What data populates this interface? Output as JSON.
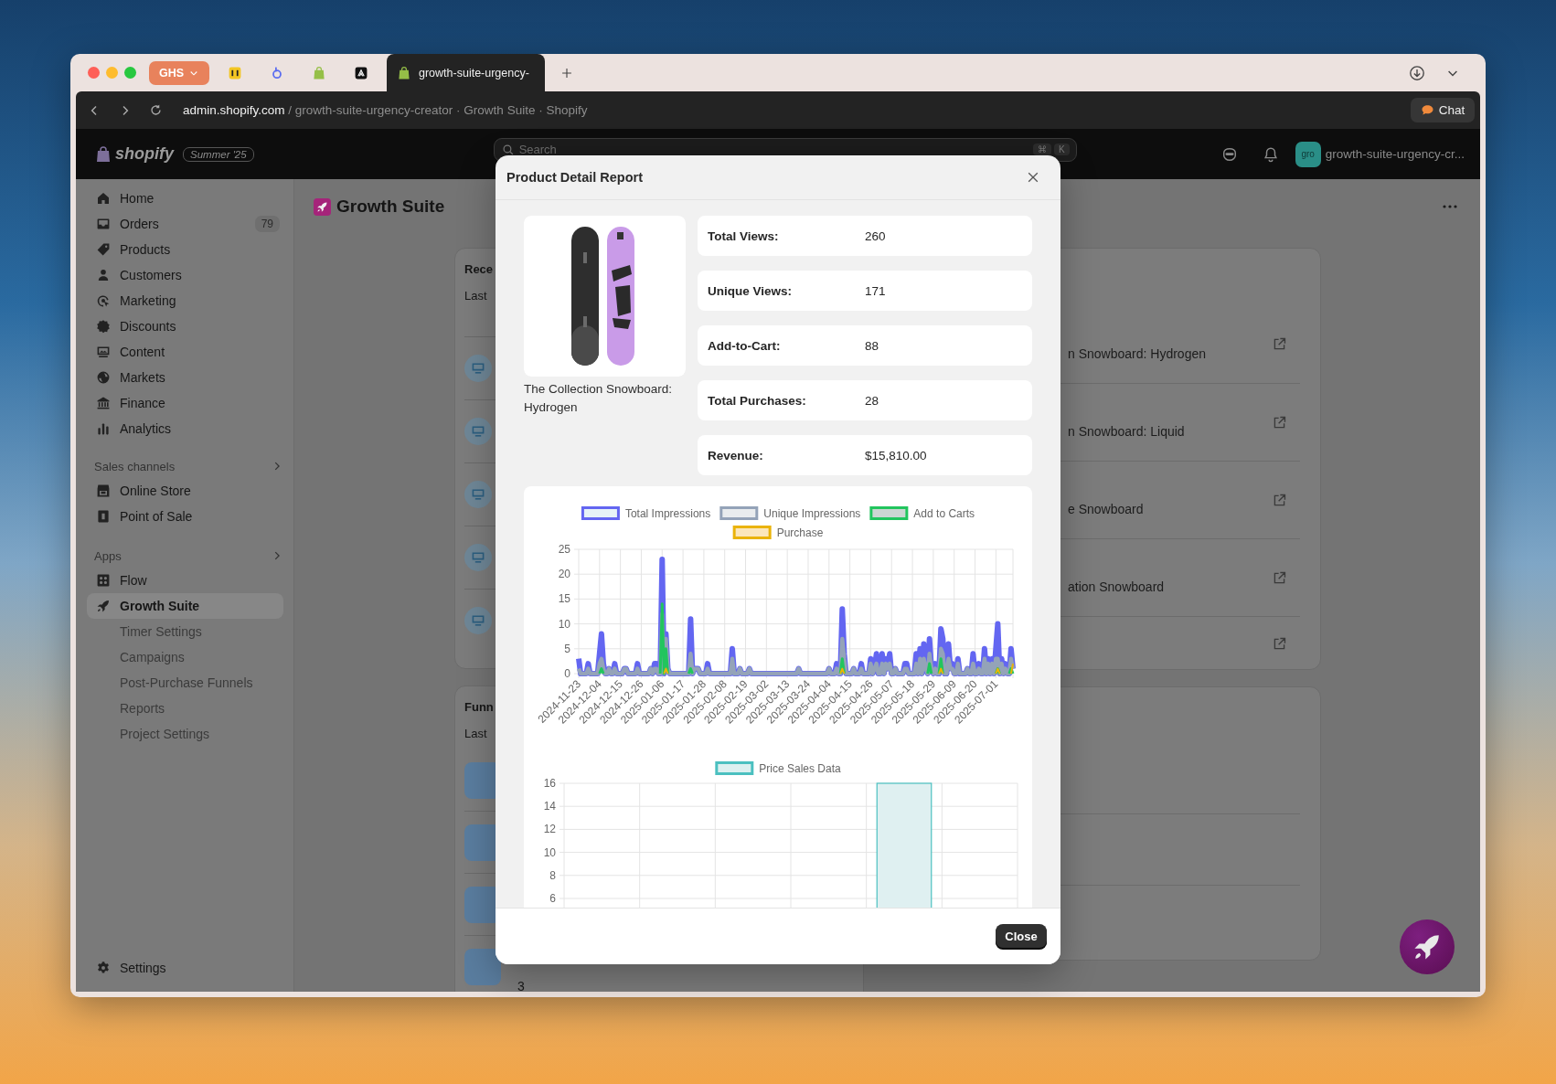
{
  "browser": {
    "profile": "GHS",
    "tabs": [
      {
        "selected": false
      },
      {
        "selected": false
      },
      {
        "selected": false
      },
      {
        "selected": false
      },
      {
        "title": "growth-suite-urgency-",
        "selected": true
      }
    ]
  },
  "address_bar": {
    "host": "admin.shopify.com",
    "path": " / growth-suite-urgency-creator · Growth Suite · Shopify",
    "chat_button": "Chat"
  },
  "topbar": {
    "logo": "shopify",
    "edition": "Summer '25",
    "search": {
      "placeholder": "Search",
      "shortcut": [
        "⌘",
        "K"
      ]
    },
    "store": {
      "avatar": "gro",
      "name": "growth-suite-urgency-cr..."
    }
  },
  "sidebar": {
    "items": [
      {
        "label": "Home",
        "selected": false
      },
      {
        "label": "Orders",
        "badge": "79",
        "selected": false
      },
      {
        "label": "Products",
        "selected": false
      },
      {
        "label": "Customers",
        "selected": false
      },
      {
        "label": "Marketing",
        "selected": false
      },
      {
        "label": "Discounts",
        "selected": false
      },
      {
        "label": "Content",
        "selected": false
      },
      {
        "label": "Markets",
        "selected": false
      },
      {
        "label": "Finance",
        "selected": false
      },
      {
        "label": "Analytics",
        "selected": false
      }
    ],
    "sections": [
      {
        "title": "Sales channels",
        "items": [
          {
            "label": "Online Store",
            "selected": false
          },
          {
            "label": "Point of Sale",
            "selected": false
          }
        ]
      },
      {
        "title": "Apps",
        "items": [
          {
            "label": "Flow",
            "selected": false
          },
          {
            "label": "Growth Suite",
            "selected": true,
            "children": [
              {
                "label": "Timer Settings",
                "selected": false
              },
              {
                "label": "Campaigns",
                "selected": false
              },
              {
                "label": "Post-Purchase Funnels",
                "selected": false
              },
              {
                "label": "Reports",
                "selected": false
              },
              {
                "label": "Project Settings",
                "selected": false
              }
            ]
          }
        ]
      }
    ],
    "footer": [
      {
        "label": "Settings",
        "selected": false
      }
    ]
  },
  "page": {
    "title": "Growth Suite"
  },
  "cards": [
    {
      "kind": "list",
      "title": "Rece",
      "subtitle": "Last",
      "rows": [
        {
          "kind": "device"
        },
        {
          "kind": "device"
        },
        {
          "kind": "device"
        },
        {
          "kind": "device"
        },
        {
          "kind": "device"
        }
      ]
    },
    {
      "kind": "list",
      "title": "Funn",
      "subtitle": "Last",
      "rows": [
        {
          "kind": "app"
        },
        {
          "kind": "app"
        },
        {
          "kind": "app"
        },
        {
          "kind": "app",
          "value": "3"
        }
      ]
    },
    {
      "kind": "links",
      "rows": [
        {
          "kind": "link",
          "text": "n Snowboard: Hydrogen"
        },
        {
          "kind": "link",
          "text": "n Snowboard: Liquid"
        },
        {
          "kind": "link",
          "text": "e Snowboard"
        },
        {
          "kind": "link",
          "text": "ation Snowboard"
        },
        {
          "kind": "link"
        }
      ]
    }
  ],
  "modal": {
    "title": "Product Detail Report",
    "product": {
      "name": "The Collection Snowboard: Hydrogen"
    },
    "stats": [
      {
        "label": "Total Views:",
        "value": "260"
      },
      {
        "label": "Unique Views:",
        "value": "171"
      },
      {
        "label": "Add-to-Cart:",
        "value": "88"
      },
      {
        "label": "Total Purchases:",
        "value": "28"
      },
      {
        "label": "Revenue:",
        "value": "$15,810.00"
      }
    ],
    "charts": [
      {
        "chart_data": {
          "type": "line",
          "grid": true,
          "legend": "top",
          "ylim": [
            0,
            25
          ],
          "yticks": [
            0,
            5,
            10,
            15,
            20,
            25
          ],
          "categories": [
            "2024-11-23",
            null,
            null,
            null,
            null,
            null,
            null,
            null,
            null,
            null,
            null,
            "2024-12-04",
            null,
            null,
            null,
            null,
            null,
            null,
            null,
            null,
            null,
            null,
            "2024-12-15",
            null,
            null,
            null,
            null,
            null,
            null,
            null,
            null,
            null,
            null,
            "2024-12-26",
            null,
            null,
            null,
            null,
            null,
            null,
            null,
            null,
            null,
            null,
            "2025-01-06",
            null,
            null,
            null,
            null,
            null,
            null,
            null,
            null,
            null,
            null,
            "2025-01-17",
            null,
            null,
            null,
            null,
            null,
            null,
            null,
            null,
            null,
            null,
            "2025-01-28",
            null,
            null,
            null,
            null,
            null,
            null,
            null,
            null,
            null,
            null,
            "2025-02-08",
            null,
            null,
            null,
            null,
            null,
            null,
            null,
            null,
            null,
            null,
            "2025-02-19",
            null,
            null,
            null,
            null,
            null,
            null,
            null,
            null,
            null,
            null,
            "2025-03-02",
            null,
            null,
            null,
            null,
            null,
            null,
            null,
            null,
            null,
            null,
            "2025-03-13",
            null,
            null,
            null,
            null,
            null,
            null,
            null,
            null,
            null,
            null,
            "2025-03-24",
            null,
            null,
            null,
            null,
            null,
            null,
            null,
            null,
            null,
            null,
            "2025-04-04",
            null,
            null,
            null,
            null,
            null,
            null,
            null,
            null,
            null,
            null,
            "2025-04-15",
            null,
            null,
            null,
            null,
            null,
            null,
            null,
            null,
            null,
            null,
            "2025-04-26",
            null,
            null,
            null,
            null,
            null,
            null,
            null,
            null,
            null,
            null,
            "2025-05-07",
            null,
            null,
            null,
            null,
            null,
            null,
            null,
            null,
            null,
            null,
            "2025-05-18",
            null,
            null,
            null,
            null,
            null,
            null,
            null,
            null,
            null,
            null,
            "2025-05-29",
            null,
            null,
            null,
            null,
            null,
            null,
            null,
            null,
            null,
            null,
            "2025-06-09",
            null,
            null,
            null,
            null,
            null,
            null,
            null,
            null,
            null,
            null,
            "2025-06-20",
            null,
            null,
            null,
            null,
            null,
            null,
            null,
            null,
            null,
            null,
            "2025-07-01",
            null,
            null,
            null,
            null,
            null,
            null,
            null,
            null,
            null
          ],
          "series": [
            {
              "name": "Total Impressions",
              "color": "#6366f1",
              "values": [
                3,
                0,
                0,
                0,
                0,
                2,
                0,
                0,
                0,
                0,
                0,
                4,
                8,
                2,
                0,
                0,
                1,
                0,
                0,
                2,
                0,
                0,
                0,
                0,
                1,
                1,
                0,
                0,
                0,
                0,
                0,
                2,
                0,
                0,
                0,
                0,
                0,
                0,
                1,
                0,
                2,
                2,
                0,
                0,
                23,
                0,
                8,
                1,
                0,
                0,
                0,
                0,
                0,
                0,
                0,
                0,
                0,
                0,
                0,
                11,
                0,
                1,
                1,
                1,
                0,
                0,
                0,
                0,
                2,
                0,
                0,
                0,
                0,
                0,
                0,
                0,
                0,
                0,
                0,
                0,
                0,
                5,
                0,
                0,
                0,
                1,
                0,
                0,
                0,
                0,
                1,
                0,
                0,
                0,
                0,
                0,
                0,
                0,
                0,
                0,
                0,
                0,
                0,
                0,
                0,
                0,
                0,
                0,
                0,
                0,
                0,
                0,
                0,
                0,
                0,
                0,
                1,
                0,
                0,
                0,
                0,
                0,
                0,
                0,
                0,
                0,
                0,
                0,
                0,
                0,
                0,
                0,
                1,
                0,
                0,
                0,
                2,
                0,
                0,
                13,
                4,
                0,
                0,
                0,
                0,
                1,
                0,
                0,
                0,
                2,
                0,
                0,
                0,
                0,
                3,
                0,
                1,
                4,
                0,
                0,
                4,
                0,
                3,
                1,
                4,
                0,
                0,
                1,
                0,
                0,
                0,
                0,
                2,
                2,
                0,
                0,
                0,
                0,
                4,
                0,
                5,
                0,
                6,
                1,
                0,
                7,
                1,
                0,
                2,
                0,
                0,
                9,
                7,
                0,
                0,
                6,
                1,
                2,
                0,
                0,
                3,
                0,
                0,
                0,
                0,
                1,
                0,
                0,
                4,
                0,
                0,
                2,
                0,
                0,
                5,
                0,
                3,
                0,
                3,
                0,
                5,
                10,
                0,
                3,
                0,
                2,
                0,
                0,
                5,
                1
              ]
            },
            {
              "name": "Unique Impressions",
              "color": "#94a3b8",
              "values": [
                1,
                0,
                0,
                0,
                0,
                1,
                0,
                0,
                0,
                0,
                0,
                2,
                3,
                1,
                0,
                0,
                1,
                0,
                0,
                1,
                0,
                0,
                0,
                0,
                1,
                1,
                0,
                0,
                0,
                0,
                0,
                1,
                0,
                0,
                0,
                0,
                0,
                0,
                1,
                0,
                1,
                1,
                0,
                0,
                12,
                0,
                7,
                1,
                0,
                0,
                0,
                0,
                0,
                0,
                0,
                0,
                0,
                0,
                0,
                4,
                0,
                1,
                1,
                1,
                0,
                0,
                0,
                0,
                1,
                0,
                0,
                0,
                0,
                0,
                0,
                0,
                0,
                0,
                0,
                0,
                0,
                3,
                0,
                0,
                0,
                1,
                0,
                0,
                0,
                0,
                1,
                0,
                0,
                0,
                0,
                0,
                0,
                0,
                0,
                0,
                0,
                0,
                0,
                0,
                0,
                0,
                0,
                0,
                0,
                0,
                0,
                0,
                0,
                0,
                0,
                0,
                1,
                0,
                0,
                0,
                0,
                0,
                0,
                0,
                0,
                0,
                0,
                0,
                0,
                0,
                0,
                0,
                1,
                0,
                0,
                0,
                1,
                0,
                0,
                7,
                3,
                0,
                0,
                0,
                0,
                1,
                0,
                0,
                0,
                1,
                0,
                0,
                0,
                0,
                2,
                0,
                1,
                2,
                0,
                0,
                2,
                0,
                2,
                1,
                2,
                0,
                0,
                1,
                0,
                0,
                0,
                0,
                1,
                1,
                0,
                0,
                0,
                0,
                2,
                0,
                3,
                0,
                3,
                1,
                0,
                4,
                1,
                0,
                1,
                0,
                0,
                5,
                4,
                0,
                0,
                3,
                1,
                1,
                0,
                0,
                2,
                0,
                0,
                0,
                0,
                1,
                0,
                0,
                2,
                0,
                0,
                1,
                0,
                0,
                3,
                0,
                2,
                0,
                2,
                0,
                3,
                3,
                0,
                2,
                0,
                1,
                0,
                0,
                3,
                1
              ]
            },
            {
              "name": "Add to Carts",
              "color": "#22c55e",
              "values": [
                null,
                null,
                null,
                null,
                null,
                null,
                null,
                null,
                null,
                null,
                null,
                0,
                1,
                0,
                null,
                null,
                null,
                null,
                null,
                null,
                null,
                null,
                null,
                null,
                null,
                null,
                null,
                null,
                null,
                null,
                null,
                null,
                null,
                null,
                null,
                null,
                null,
                null,
                null,
                null,
                null,
                null,
                null,
                0,
                14,
                0,
                5,
                0,
                null,
                null,
                null,
                null,
                null,
                null,
                null,
                null,
                null,
                null,
                0,
                1,
                0,
                null,
                null,
                null,
                null,
                null,
                null,
                null,
                null,
                null,
                null,
                null,
                null,
                null,
                null,
                null,
                null,
                null,
                null,
                null,
                null,
                null,
                null,
                null,
                null,
                null,
                null,
                null,
                null,
                null,
                null,
                null,
                null,
                null,
                null,
                null,
                null,
                null,
                null,
                null,
                null,
                null,
                null,
                null,
                null,
                null,
                null,
                null,
                null,
                null,
                null,
                null,
                null,
                null,
                null,
                null,
                null,
                null,
                null,
                null,
                null,
                null,
                null,
                null,
                null,
                null,
                null,
                null,
                null,
                null,
                null,
                null,
                null,
                null,
                null,
                null,
                null,
                null,
                0,
                3,
                0,
                null,
                null,
                null,
                null,
                null,
                null,
                null,
                null,
                null,
                null,
                null,
                null,
                null,
                null,
                null,
                null,
                null,
                null,
                null,
                null,
                null,
                null,
                null,
                null,
                null,
                null,
                null,
                null,
                null,
                null,
                null,
                null,
                null,
                null,
                null,
                null,
                null,
                null,
                null,
                null,
                null,
                null,
                null,
                0,
                2,
                0,
                null,
                null,
                null,
                0,
                3,
                0,
                null,
                null,
                null,
                null,
                null,
                null,
                null,
                null,
                null,
                null,
                null,
                null,
                null,
                null,
                null,
                null,
                null,
                null,
                null,
                null,
                null,
                null,
                null,
                null,
                null,
                null,
                null,
                0,
                1,
                0,
                null,
                null,
                null,
                null,
                0,
                1,
                0
              ]
            },
            {
              "name": "Purchase",
              "color": "#eab308",
              "values": [
                null,
                null,
                null,
                null,
                null,
                null,
                null,
                null,
                null,
                null,
                null,
                null,
                null,
                null,
                null,
                null,
                null,
                null,
                null,
                null,
                null,
                null,
                null,
                null,
                null,
                null,
                null,
                null,
                null,
                null,
                null,
                null,
                null,
                null,
                null,
                null,
                null,
                null,
                null,
                null,
                null,
                null,
                null,
                null,
                null,
                0,
                1,
                0,
                null,
                null,
                null,
                null,
                null,
                null,
                null,
                null,
                null,
                null,
                null,
                null,
                null,
                null,
                null,
                null,
                null,
                null,
                null,
                null,
                null,
                null,
                null,
                null,
                null,
                null,
                null,
                null,
                null,
                null,
                null,
                null,
                null,
                null,
                null,
                null,
                null,
                null,
                null,
                null,
                null,
                null,
                null,
                null,
                null,
                null,
                null,
                null,
                null,
                null,
                null,
                null,
                null,
                null,
                null,
                null,
                null,
                null,
                null,
                null,
                null,
                null,
                null,
                null,
                null,
                null,
                null,
                null,
                null,
                null,
                null,
                null,
                null,
                null,
                null,
                null,
                null,
                null,
                null,
                null,
                null,
                null,
                null,
                null,
                null,
                null,
                null,
                null,
                null,
                null,
                0,
                1,
                0,
                null,
                null,
                null,
                null,
                null,
                null,
                null,
                null,
                null,
                null,
                null,
                null,
                null,
                null,
                null,
                null,
                null,
                null,
                null,
                null,
                null,
                null,
                null,
                null,
                null,
                null,
                null,
                null,
                null,
                null,
                null,
                null,
                null,
                null,
                null,
                null,
                null,
                null,
                null,
                null,
                null,
                null,
                null,
                null,
                null,
                null,
                null,
                null,
                null,
                0,
                1,
                0,
                null,
                null,
                null,
                null,
                null,
                null,
                null,
                null,
                null,
                null,
                null,
                null,
                null,
                null,
                null,
                null,
                null,
                null,
                null,
                null,
                null,
                null,
                null,
                null,
                null,
                null,
                null,
                0,
                1,
                0,
                null,
                null,
                null,
                null,
                null,
                0,
                2
              ]
            }
          ]
        }
      },
      {
        "chart_data": {
          "type": "bar",
          "grid": true,
          "legend": "top",
          "ylim": [
            5,
            16
          ],
          "yticks": [
            6,
            8,
            10,
            12,
            14,
            16
          ],
          "series": [
            {
              "name": "Price Sales Data",
              "color": "#4bc0c0",
              "values": [
                null,
                null,
                null,
                null,
                16,
                null
              ]
            }
          ]
        }
      }
    ],
    "close_button": "Close"
  }
}
